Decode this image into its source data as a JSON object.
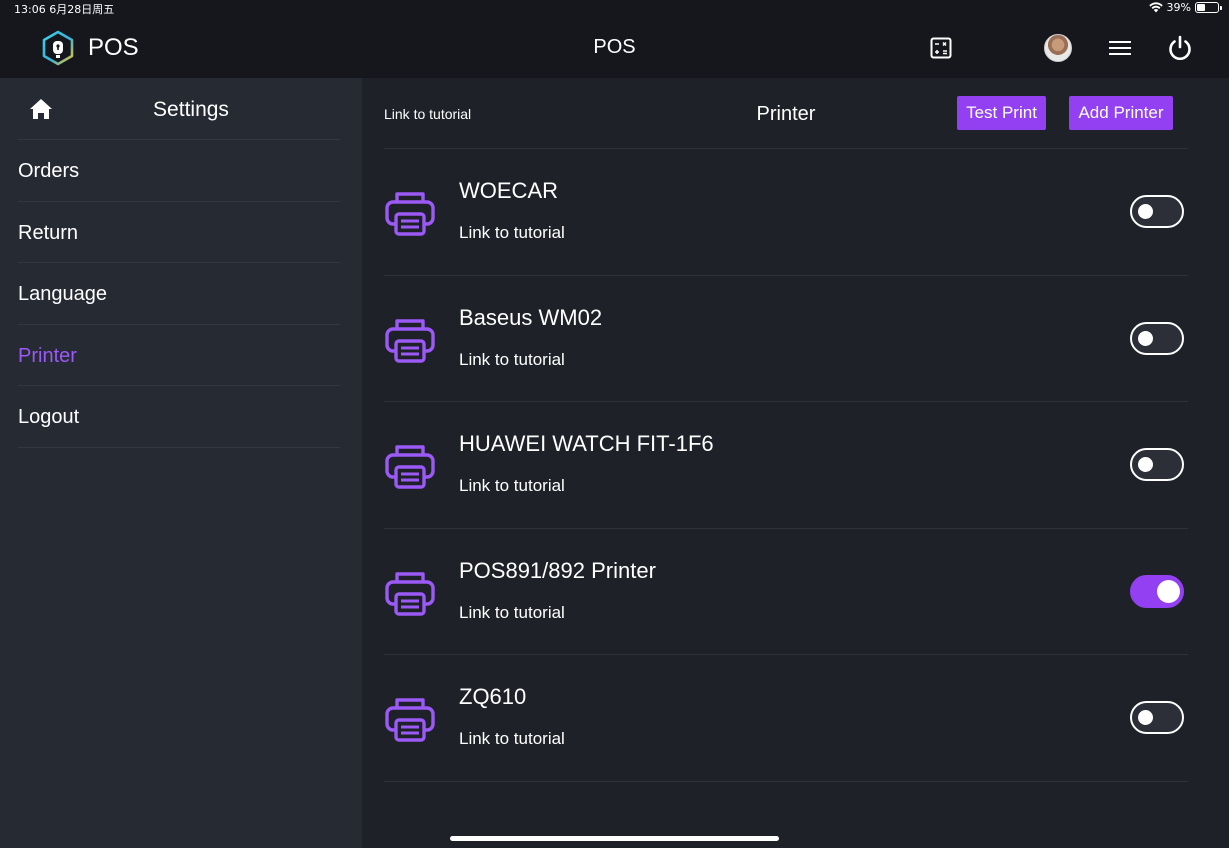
{
  "status_bar": {
    "time": "13:06  6月28日周五",
    "battery": "39%",
    "battery_level": 0.39
  },
  "topbar": {
    "brand": "POS",
    "title": "POS",
    "icons": [
      "calculator-icon",
      "avatar",
      "menu-icon",
      "power-icon"
    ]
  },
  "sidebar": {
    "title": "Settings",
    "items": [
      {
        "label": "Orders",
        "active": false
      },
      {
        "label": "Return",
        "active": false
      },
      {
        "label": "Language",
        "active": false
      },
      {
        "label": "Printer",
        "active": true
      },
      {
        "label": "Logout",
        "active": false
      }
    ]
  },
  "main": {
    "tutorial_link": "Link to tutorial",
    "title": "Printer",
    "test_print_label": "Test Print",
    "add_printer_label": "Add Printer",
    "printers": [
      {
        "name": "WOECAR",
        "link": "Link to tutorial",
        "enabled": false
      },
      {
        "name": "Baseus WM02",
        "link": "Link to tutorial",
        "enabled": false
      },
      {
        "name": "HUAWEI WATCH FIT-1F6",
        "link": "Link to tutorial",
        "enabled": false
      },
      {
        "name": "POS891/892 Printer",
        "link": "Link to tutorial",
        "enabled": true
      },
      {
        "name": "ZQ610",
        "link": "Link to tutorial",
        "enabled": false
      }
    ]
  },
  "colors": {
    "accent": "#9240f2",
    "active_text": "#9b59f5",
    "sidebar_bg": "#262a33",
    "main_bg": "#1e2128",
    "topbar_bg": "#15171c"
  }
}
